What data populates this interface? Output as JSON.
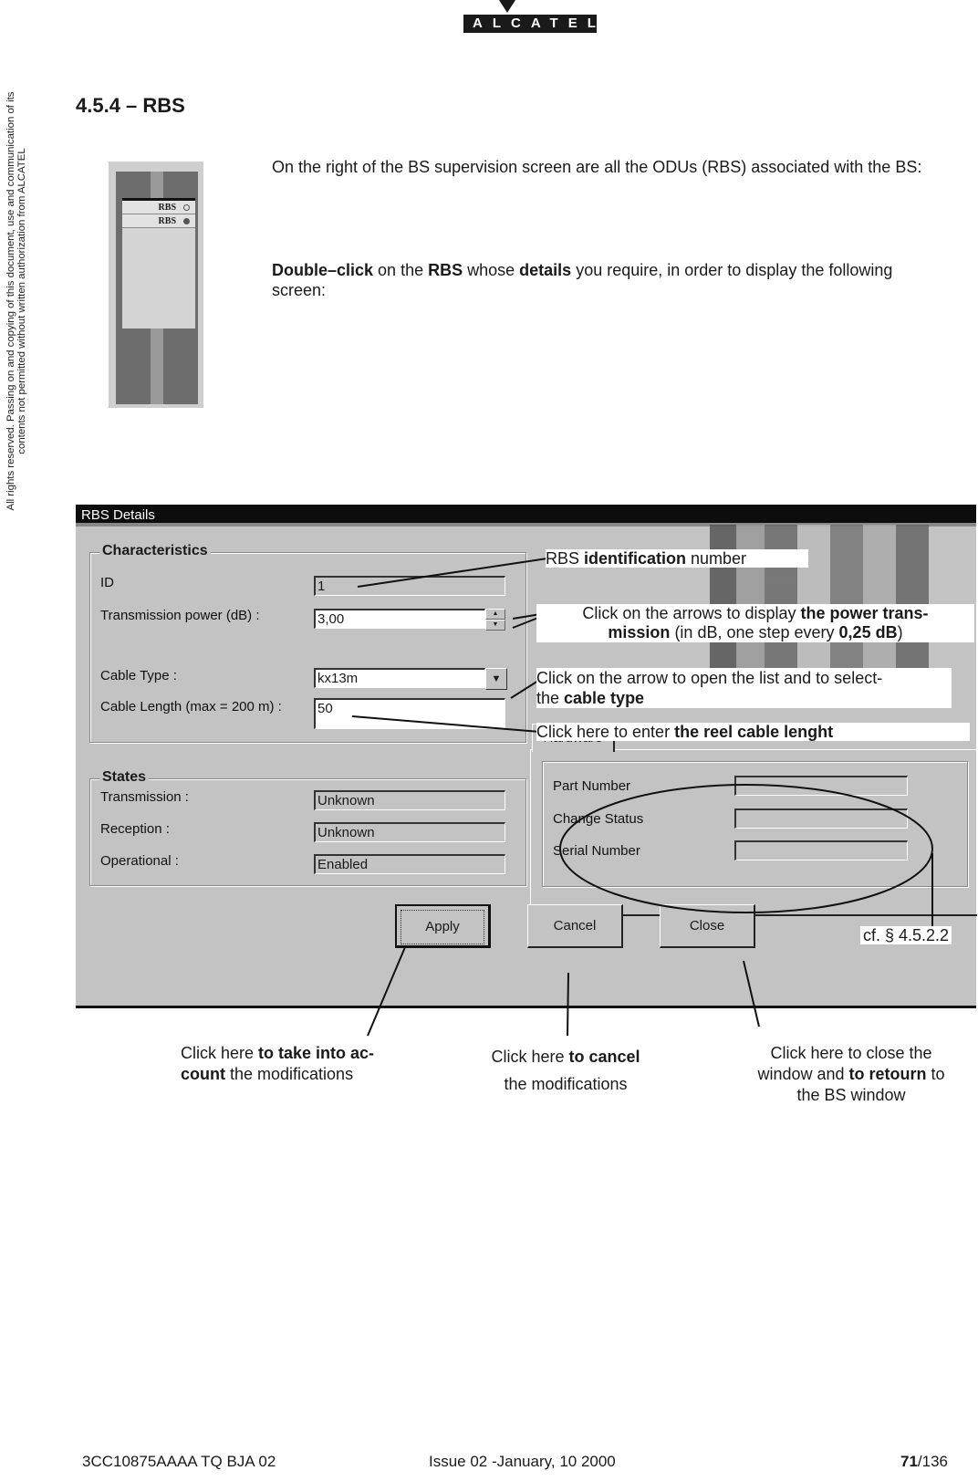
{
  "header": {
    "logo_text": "ALCATEL",
    "side_notice": "All rights reserved. Passing on and copying of this document, use and communication of its contents not permitted without written authorization from ALCATEL"
  },
  "section": {
    "title": "4.5.4 – RBS"
  },
  "thumbnail": {
    "rows": [
      {
        "label": "RBS",
        "icon": "hollow-circle-icon"
      },
      {
        "label": "RBS",
        "icon": "filled-circle-icon"
      }
    ]
  },
  "paragraphs": {
    "p1": "On the right of the BS supervision screen are all the ODUs (RBS) associated with the BS:",
    "p2_bold_1": "Double–click",
    "p2_text_1": " on the ",
    "p2_bold_2": "RBS",
    "p2_text_2": " whose ",
    "p2_bold_3": "details",
    "p2_text_3": " you require, in order to display the following screen:"
  },
  "dialog": {
    "title": "RBS Details",
    "characteristics": {
      "title": "Characteristics",
      "id_label": "ID",
      "id_value": "1",
      "power_label": "Transmission power (dB) :",
      "power_value": "3,00",
      "cable_type_label": "Cable Type :",
      "cable_type_value": "kx13m",
      "cable_length_label": "Cable Length (max = 200 m) :",
      "cable_length_value": "50"
    },
    "states": {
      "title": "States",
      "transmission_label": "Transmission :",
      "transmission_value": "Unknown",
      "reception_label": "Reception :",
      "reception_value": "Unknown",
      "operational_label": "Operational :",
      "operational_value": "Enabled"
    },
    "hardware": {
      "tab_label": "Hardware",
      "part_number_label": "Part Number",
      "part_number_value": "",
      "change_status_label": "Change Status",
      "change_status_value": "",
      "serial_number_label": "Serial Number",
      "serial_number_value": ""
    },
    "buttons": {
      "apply": "Apply",
      "cancel": "Cancel",
      "close": "Close"
    }
  },
  "callouts": {
    "id_a": "RBS ",
    "id_b": "identification",
    "id_c": " number",
    "power_a": "Click on the arrows to display ",
    "power_b": "the power  trans-",
    "power_c": "mission",
    "power_d": " (in dB, one step every ",
    "power_e": "0,25 dB",
    "power_f": ")",
    "cable_a": "Click on the arrow to open the list and to select-",
    "cable_b": "the ",
    "cable_c": "cable type",
    "length_a": "Click here to enter ",
    "length_b": "the reel cable lenght",
    "ref": "cf. § 4.5.2.2"
  },
  "captions": {
    "apply_a": "Click here ",
    "apply_b": "to take into ac-",
    "apply_c": "count",
    "apply_d": " the modifications",
    "cancel_a": "Click here ",
    "cancel_b": "to cancel",
    "cancel_c": "the modifications",
    "close_a": "Click here to close the",
    "close_b": "window and ",
    "close_c": "to retourn",
    "close_d": " to",
    "close_e": "the BS window"
  },
  "footer": {
    "doc_ref": "3CC10875AAAA TQ BJA 02",
    "issue": "Issue 02 -January, 10 2000",
    "page_current": "71",
    "page_total": "/136"
  }
}
